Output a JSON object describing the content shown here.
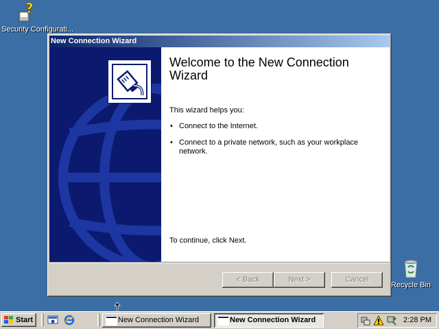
{
  "desktop": {
    "icons": [
      {
        "label": "Security Configurati..."
      },
      {
        "label": "Recycle Bin"
      }
    ]
  },
  "window": {
    "title": "New Connection Wizard",
    "heading": "Welcome to the New Connection Wizard",
    "intro": "This wizard helps you:",
    "bullets": [
      "Connect to the Internet.",
      "Connect to a private network, such as your workplace network."
    ],
    "continue_text": "To continue, click Next.",
    "buttons": {
      "back": "< Back",
      "next": "Next >",
      "cancel": "Cancel"
    }
  },
  "taskbar": {
    "start_label": "Start",
    "tasks": [
      {
        "label": "New Connection Wizard",
        "active": false
      },
      {
        "label": "New Connection Wizard",
        "active": true
      }
    ],
    "clock": "2:28 PM"
  },
  "colors": {
    "desktop": "#3a6ea5",
    "title_active": "#0a246a",
    "wizard_side": "#0b1a6f",
    "chrome": "#d4d0c8"
  }
}
